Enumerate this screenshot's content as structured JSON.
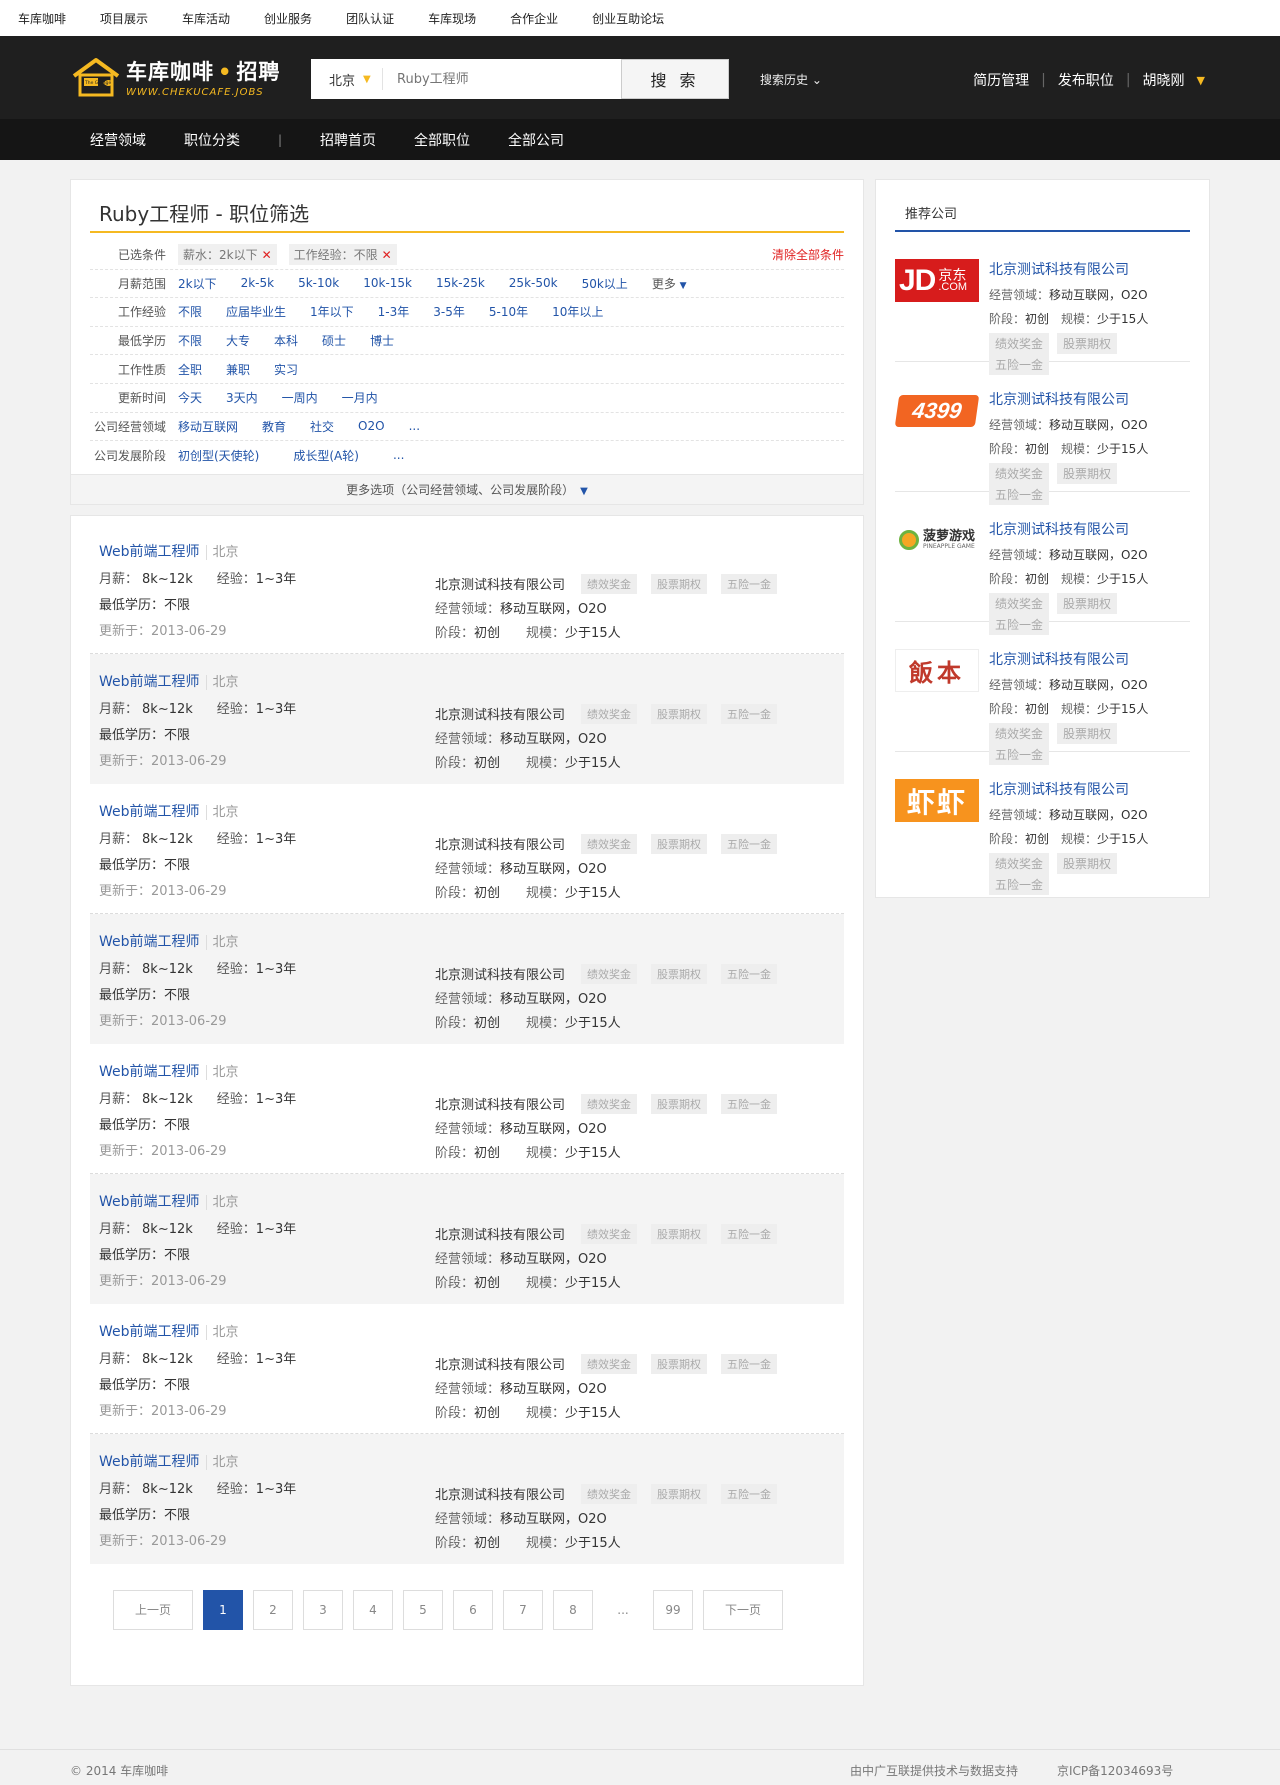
{
  "topbar": {
    "links": [
      "车库咖啡",
      "项目展示",
      "车库活动",
      "创业服务",
      "团队认证",
      "车库现场",
      "合作企业",
      "创业互助论坛"
    ]
  },
  "header": {
    "logo_title_a": "车库咖啡",
    "logo_dot": "•",
    "logo_title_b": "招聘",
    "logo_sub": "WWW.CHEKUCAFE.JOBS",
    "logo_house_text": "The Garage",
    "city": "北京",
    "search_placeholder": "Ruby工程师",
    "search_button": "搜 索",
    "history": "搜索历史 ⌄",
    "resume": "简历管理",
    "post_job": "发布职位",
    "username": "胡晓刚",
    "accent": "#f5b921"
  },
  "nav": {
    "items": [
      "经营领域",
      "职位分类",
      "招聘首页",
      "全部职位",
      "全部公司"
    ]
  },
  "filter": {
    "title": "Ruby工程师 - 职位筛选",
    "selected_label": "已选条件",
    "chips": [
      "薪水：2k以下",
      "工作经验：不限"
    ],
    "clear_all": "清除全部条件",
    "rows": [
      {
        "label": "月薪范围",
        "options": [
          "2k以下",
          "2k-5k",
          "5k-10k",
          "10k-15k",
          "15k-25k",
          "25k-50k",
          "50k以上"
        ],
        "more": "更多"
      },
      {
        "label": "工作经验",
        "options": [
          "不限",
          "应届毕业生",
          "1年以下",
          "1-3年",
          "3-5年",
          "5-10年",
          "10年以上"
        ]
      },
      {
        "label": "最低学历",
        "options": [
          "不限",
          "大专",
          "本科",
          "硕士",
          "博士"
        ]
      },
      {
        "label": "工作性质",
        "options": [
          "全职",
          "兼职",
          "实习"
        ]
      },
      {
        "label": "更新时间",
        "options": [
          "今天",
          "3天内",
          "一周内",
          "一月内"
        ]
      },
      {
        "label": "公司经营领域",
        "options": [
          "移动互联网",
          "教育",
          "社交",
          "O2O",
          "..."
        ]
      },
      {
        "label": "公司发展阶段",
        "options": [
          "初创型(天使轮)",
          "成长型(A轮)",
          "..."
        ]
      }
    ],
    "more_options": "更多选项（公司经营领域、公司发展阶段）"
  },
  "jobs": [
    {
      "title": "Web前端工程师",
      "city": "北京",
      "salary_label": "月薪：",
      "salary": "8k~12k",
      "exp_label": "经验：",
      "exp": "1~3年",
      "edu": "最低学历：不限",
      "updated": "更新于：2013-06-29",
      "company": "北京测试科技有限公司",
      "tags": [
        "绩效奖金",
        "股票期权",
        "五险一金"
      ],
      "field_label": "经营领域：",
      "field": "移动互联网，O2O",
      "stage_label": "阶段：",
      "stage": "初创",
      "scale_label": "规模：",
      "scale": "少于15人"
    },
    {
      "title": "Web前端工程师",
      "city": "北京",
      "salary_label": "月薪：",
      "salary": "8k~12k",
      "exp_label": "经验：",
      "exp": "1~3年",
      "edu": "最低学历：不限",
      "updated": "更新于：2013-06-29",
      "company": "北京测试科技有限公司",
      "tags": [
        "绩效奖金",
        "股票期权",
        "五险一金"
      ],
      "field_label": "经营领域：",
      "field": "移动互联网，O2O",
      "stage_label": "阶段：",
      "stage": "初创",
      "scale_label": "规模：",
      "scale": "少于15人"
    },
    {
      "title": "Web前端工程师",
      "city": "北京",
      "salary_label": "月薪：",
      "salary": "8k~12k",
      "exp_label": "经验：",
      "exp": "1~3年",
      "edu": "最低学历：不限",
      "updated": "更新于：2013-06-29",
      "company": "北京测试科技有限公司",
      "tags": [
        "绩效奖金",
        "股票期权",
        "五险一金"
      ],
      "field_label": "经营领域：",
      "field": "移动互联网，O2O",
      "stage_label": "阶段：",
      "stage": "初创",
      "scale_label": "规模：",
      "scale": "少于15人"
    },
    {
      "title": "Web前端工程师",
      "city": "北京",
      "salary_label": "月薪：",
      "salary": "8k~12k",
      "exp_label": "经验：",
      "exp": "1~3年",
      "edu": "最低学历：不限",
      "updated": "更新于：2013-06-29",
      "company": "北京测试科技有限公司",
      "tags": [
        "绩效奖金",
        "股票期权",
        "五险一金"
      ],
      "field_label": "经营领域：",
      "field": "移动互联网，O2O",
      "stage_label": "阶段：",
      "stage": "初创",
      "scale_label": "规模：",
      "scale": "少于15人"
    },
    {
      "title": "Web前端工程师",
      "city": "北京",
      "salary_label": "月薪：",
      "salary": "8k~12k",
      "exp_label": "经验：",
      "exp": "1~3年",
      "edu": "最低学历：不限",
      "updated": "更新于：2013-06-29",
      "company": "北京测试科技有限公司",
      "tags": [
        "绩效奖金",
        "股票期权",
        "五险一金"
      ],
      "field_label": "经营领域：",
      "field": "移动互联网，O2O",
      "stage_label": "阶段：",
      "stage": "初创",
      "scale_label": "规模：",
      "scale": "少于15人"
    },
    {
      "title": "Web前端工程师",
      "city": "北京",
      "salary_label": "月薪：",
      "salary": "8k~12k",
      "exp_label": "经验：",
      "exp": "1~3年",
      "edu": "最低学历：不限",
      "updated": "更新于：2013-06-29",
      "company": "北京测试科技有限公司",
      "tags": [
        "绩效奖金",
        "股票期权",
        "五险一金"
      ],
      "field_label": "经营领域：",
      "field": "移动互联网，O2O",
      "stage_label": "阶段：",
      "stage": "初创",
      "scale_label": "规模：",
      "scale": "少于15人"
    },
    {
      "title": "Web前端工程师",
      "city": "北京",
      "salary_label": "月薪：",
      "salary": "8k~12k",
      "exp_label": "经验：",
      "exp": "1~3年",
      "edu": "最低学历：不限",
      "updated": "更新于：2013-06-29",
      "company": "北京测试科技有限公司",
      "tags": [
        "绩效奖金",
        "股票期权",
        "五险一金"
      ],
      "field_label": "经营领域：",
      "field": "移动互联网，O2O",
      "stage_label": "阶段：",
      "stage": "初创",
      "scale_label": "规模：",
      "scale": "少于15人"
    },
    {
      "title": "Web前端工程师",
      "city": "北京",
      "salary_label": "月薪：",
      "salary": "8k~12k",
      "exp_label": "经验：",
      "exp": "1~3年",
      "edu": "最低学历：不限",
      "updated": "更新于：2013-06-29",
      "company": "北京测试科技有限公司",
      "tags": [
        "绩效奖金",
        "股票期权",
        "五险一金"
      ],
      "field_label": "经营领域：",
      "field": "移动互联网，O2O",
      "stage_label": "阶段：",
      "stage": "初创",
      "scale_label": "规模：",
      "scale": "少于15人"
    }
  ],
  "pagination": {
    "prev": "上一页",
    "pages": [
      "1",
      "2",
      "3",
      "4",
      "5",
      "6",
      "7",
      "8",
      "...",
      "99"
    ],
    "active": "1",
    "next": "下一页"
  },
  "sidebar": {
    "title": "推荐公司",
    "companies": [
      {
        "logo": "jd-logo",
        "logo_text": "JD",
        "logo_text2": "京东",
        "logo_text3": ".COM",
        "name": "北京测试科技有限公司",
        "field_label": "经营领域：",
        "field": "移动互联网，O2O",
        "stage_label": "阶段：",
        "stage": "初创",
        "scale_label": "规模：",
        "scale": "少于15人",
        "tags": [
          "绩效奖金",
          "股票期权",
          "五险一金"
        ]
      },
      {
        "logo": "4399-logo",
        "logo_text": "4399",
        "name": "北京测试科技有限公司",
        "field_label": "经营领域：",
        "field": "移动互联网，O2O",
        "stage_label": "阶段：",
        "stage": "初创",
        "scale_label": "规模：",
        "scale": "少于15人",
        "tags": [
          "绩效奖金",
          "股票期权",
          "五险一金"
        ]
      },
      {
        "logo": "pineapple-game-logo",
        "logo_text": "菠萝游戏",
        "logo_text2": "PINEAPPLE GAME",
        "name": "北京测试科技有限公司",
        "field_label": "经营领域：",
        "field": "移动互联网，O2O",
        "stage_label": "阶段：",
        "stage": "初创",
        "scale_label": "规模：",
        "scale": "少于15人",
        "tags": [
          "绩效奖金",
          "股票期权",
          "五险一金"
        ]
      },
      {
        "logo": "fanben-logo",
        "logo_text": "飯本",
        "name": "北京测试科技有限公司",
        "field_label": "经营领域：",
        "field": "移动互联网，O2O",
        "stage_label": "阶段：",
        "stage": "初创",
        "scale_label": "规模：",
        "scale": "少于15人",
        "tags": [
          "绩效奖金",
          "股票期权",
          "五险一金"
        ]
      },
      {
        "logo": "xiaxia-logo",
        "logo_text": "虾虾",
        "name": "北京测试科技有限公司",
        "field_label": "经营领域：",
        "field": "移动互联网，O2O",
        "stage_label": "阶段：",
        "stage": "初创",
        "scale_label": "规模：",
        "scale": "少于15人",
        "tags": [
          "绩效奖金",
          "股票期权",
          "五险一金"
        ]
      }
    ]
  },
  "footer": {
    "copyright": "© 2014 车库咖啡",
    "support": "由中广互联提供技术与数据支持",
    "icp": "京ICP备12034693号"
  },
  "colors": {
    "accent": "#f5b921",
    "link": "#2254a8",
    "danger": "#e02222",
    "header_bg": "#1f1f1f"
  }
}
